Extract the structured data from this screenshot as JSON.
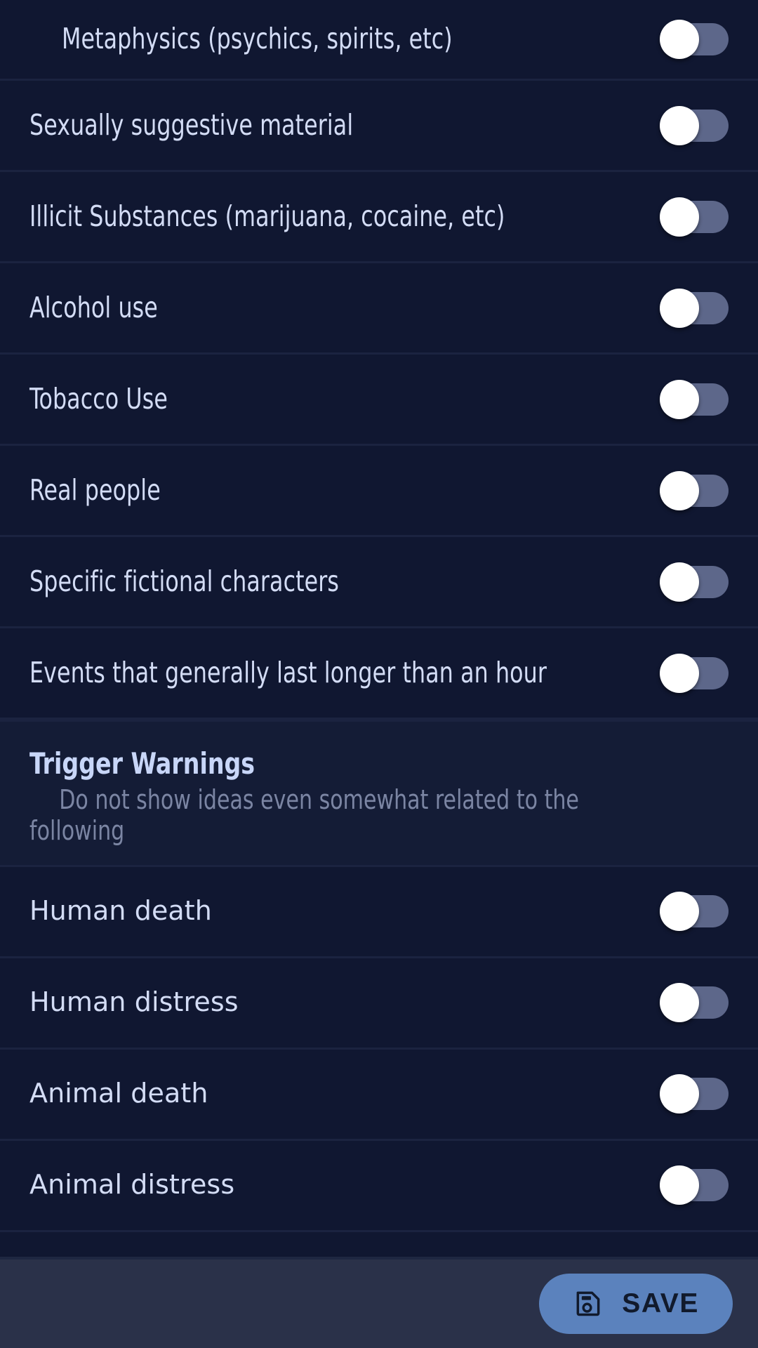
{
  "screen": {
    "name": "content-preferences-settings",
    "background_color": "#101731",
    "row_divider_color": "#1b2340",
    "accent_color": "#5b82bd",
    "toggle_track_color": "#5d678a",
    "toggle_knob_color": "#ffffff"
  },
  "top_items": [
    {
      "label": "Metaphysics (psychics, spirits, etc)",
      "toggle": "off"
    },
    {
      "label": "Sexually suggestive material",
      "toggle": "off"
    },
    {
      "label": "Illicit Substances (marijuana, cocaine, etc)",
      "toggle": "off"
    },
    {
      "label": "Alcohol use",
      "toggle": "off"
    },
    {
      "label": "Tobacco Use",
      "toggle": "off"
    },
    {
      "label": "Real people",
      "toggle": "off"
    },
    {
      "label": "Specific fictional characters",
      "toggle": "off"
    },
    {
      "label": "Events that generally last longer than an hour",
      "toggle": "off"
    }
  ],
  "section": {
    "title": "Trigger Warnings",
    "description": "Do not show ideas even somewhat related to the following"
  },
  "trigger_items": [
    {
      "label": "Human death",
      "toggle": "off"
    },
    {
      "label": "Human distress",
      "toggle": "off"
    },
    {
      "label": "Animal death",
      "toggle": "off"
    },
    {
      "label": "Animal distress",
      "toggle": "off"
    }
  ],
  "bottom_bar": {
    "save_label": "SAVE",
    "save_icon": "floppy-disk-save-icon",
    "background_color": "#2a3149"
  }
}
